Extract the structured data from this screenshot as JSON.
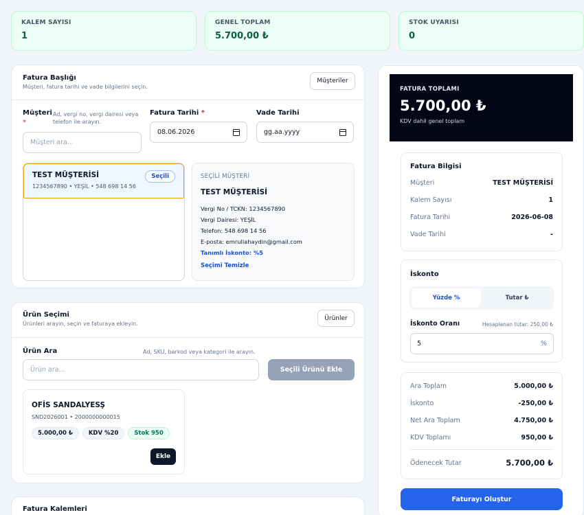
{
  "stats": [
    {
      "label": "KALEM SAYISI",
      "value": "1"
    },
    {
      "label": "GENEL TOPLAM",
      "value": "5.700,00 ₺"
    },
    {
      "label": "STOK UYARISI",
      "value": "0"
    }
  ],
  "header_card": {
    "title": "Fatura Başlığı",
    "subtitle": "Müşteri, fatura tarihi ve vade bilgilerini seçin.",
    "customers_button": "Müşteriler",
    "customer_label": "Müşteri",
    "required_mark": "*",
    "customer_hint": "Ad, vergi no, vergi dairesi veya telefon ile arayın.",
    "customer_placeholder": "Müşteri ara...",
    "invoice_date_label": "Fatura Tarihi",
    "invoice_date_value": "08.06.2026",
    "due_date_label": "Vade Tarihi",
    "due_date_value": "gg.aa.yyyy",
    "result": {
      "name": "TEST MÜŞTERİSİ",
      "details": "1234567890 • YEŞİL • 548 698 14 56",
      "badge": "Seçili"
    },
    "selected": {
      "heading": "SEÇİLİ MÜŞTERİ",
      "name": "TEST MÜŞTERİSİ",
      "tax_no": "Vergi No / TCKN: 1234567890",
      "tax_office": "Vergi Dairesi: YEŞİL",
      "phone": "Telefon: 548 698 14 56",
      "email": "E-posta: emrullahaydin@gmail.com",
      "discount": "Tanımlı İskonto: %5",
      "clear": "Seçimi Temizle"
    }
  },
  "product_card": {
    "title": "Ürün Seçimi",
    "subtitle": "Ürünleri arayın, seçin ve faturaya ekleyin.",
    "products_button": "Ürünler",
    "search_label": "Ürün Ara",
    "search_hint": "Ad, SKU, barkod veya kategori ile arayın.",
    "search_placeholder": "Ürün ara...",
    "add_selected_button": "Seçili Ürünü Ekle",
    "product": {
      "name": "OFİS SANDALYESŞ",
      "codes": "SND2026001 • 2000000000015",
      "price": "5.000,00 ₺",
      "vat": "KDV %20",
      "stock": "Stok 950",
      "add_button": "Ekle"
    }
  },
  "items_card": {
    "title": "Fatura Kalemleri"
  },
  "summary": {
    "total_label": "FATURA TOPLAMI",
    "total_value": "5.700,00 ₺",
    "total_note": "KDV dahil genel toplam",
    "info": {
      "title": "Fatura Bilgisi",
      "rows": [
        {
          "k": "Müşteri",
          "v": "TEST MÜŞTERİSİ"
        },
        {
          "k": "Kalem Sayısı",
          "v": "1"
        },
        {
          "k": "Fatura Tarihi",
          "v": "2026-06-08"
        },
        {
          "k": "Vade Tarihi",
          "v": "-"
        }
      ]
    },
    "discount": {
      "title": "İskonto",
      "tab_percent": "Yüzde %",
      "tab_amount": "Tutar ₺",
      "rate_label": "İskonto Oranı",
      "computed": "Hesaplanan tutar: 250,00 ₺",
      "rate_value": "5",
      "rate_unit": "%"
    },
    "totals": {
      "rows": [
        {
          "k": "Ara Toplam",
          "v": "5.000,00 ₺"
        },
        {
          "k": "İskonto",
          "v": "-250,00 ₺"
        },
        {
          "k": "Net Ara Toplam",
          "v": "4.750,00 ₺"
        },
        {
          "k": "KDV Toplamı",
          "v": "950,00 ₺"
        }
      ],
      "payable_label": "Ödenecek Tutar",
      "payable_value": "5.700,00 ₺"
    },
    "create_button": "Faturayı Oluştur"
  },
  "colors": {
    "accent": "#2563eb",
    "dark": "#020617",
    "success_bg": "#ecfdf5"
  }
}
